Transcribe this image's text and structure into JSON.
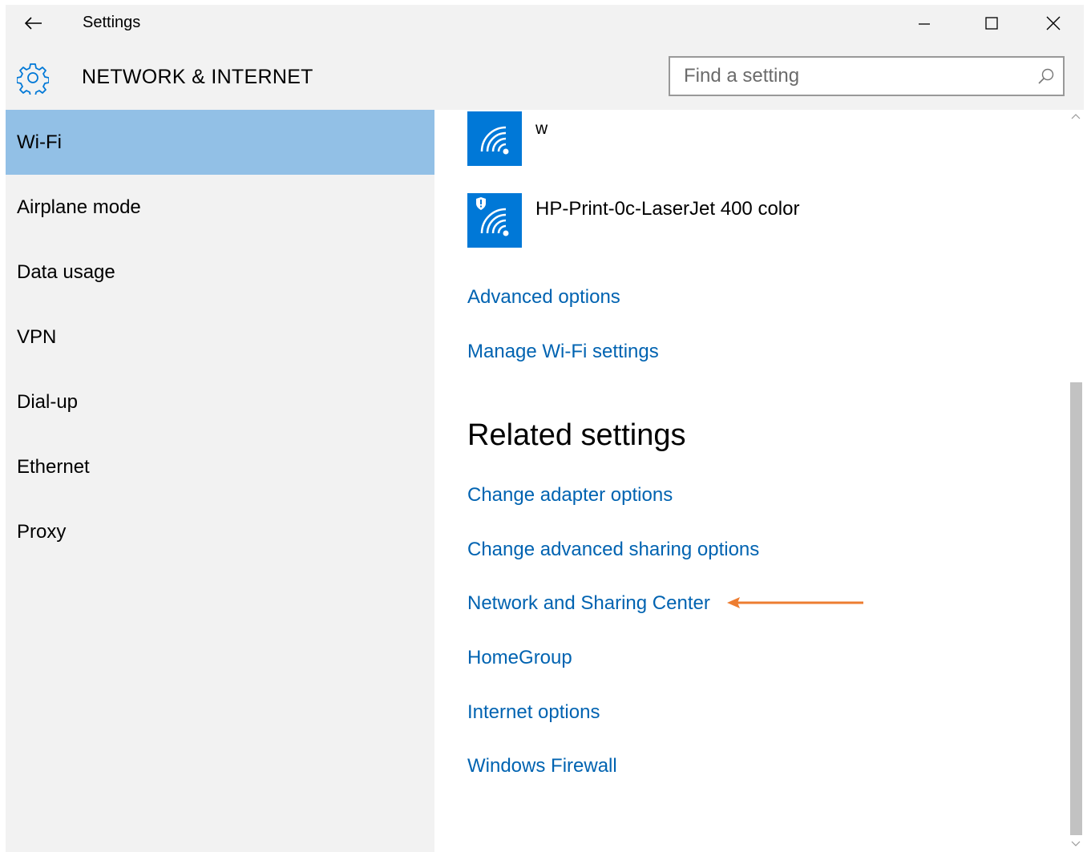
{
  "window": {
    "title": "Settings",
    "back_icon": "back-arrow-icon",
    "controls": [
      "minimize-icon",
      "maximize-icon",
      "close-icon"
    ]
  },
  "header": {
    "icon": "gear-icon",
    "title": "NETWORK & INTERNET",
    "search_placeholder": "Find a setting",
    "search_value": "",
    "search_icon": "search-icon"
  },
  "sidebar": {
    "items": [
      {
        "label": "Wi-Fi",
        "selected": true
      },
      {
        "label": "Airplane mode",
        "selected": false
      },
      {
        "label": "Data usage",
        "selected": false
      },
      {
        "label": "VPN",
        "selected": false
      },
      {
        "label": "Dial-up",
        "selected": false
      },
      {
        "label": "Ethernet",
        "selected": false
      },
      {
        "label": "Proxy",
        "selected": false
      }
    ]
  },
  "main": {
    "networks": [
      {
        "name": "w",
        "icon": "wifi-icon",
        "secured": false
      },
      {
        "name": "HP-Print-0c-LaserJet 400 color",
        "icon": "wifi-shield-icon",
        "secured": true
      }
    ],
    "links": {
      "advanced_options": "Advanced options",
      "manage_wifi": "Manage Wi-Fi settings"
    },
    "related": {
      "heading": "Related settings",
      "items": [
        "Change adapter options",
        "Change advanced sharing options",
        "Network and Sharing Center",
        "HomeGroup",
        "Internet options",
        "Windows Firewall"
      ]
    }
  },
  "annotation": {
    "type": "arrow",
    "color": "#ed7d31",
    "points_to": "Network and Sharing Center"
  },
  "colors": {
    "accent": "#0078d7",
    "link": "#0063b1",
    "selected_nav": "#92c0e6",
    "window_bg": "#f2f2f2"
  }
}
